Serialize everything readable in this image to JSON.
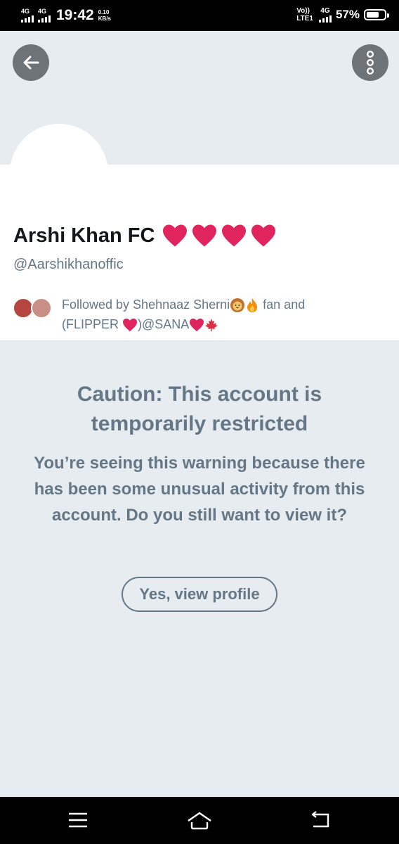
{
  "status_bar": {
    "network_1": "4G",
    "network_2": "4G",
    "time": "19:42",
    "speed_value": "0.10",
    "speed_unit": "KB/s",
    "volte_top": "Vo))",
    "volte_bottom": "LTE1",
    "data_type": "4G",
    "battery": "57%"
  },
  "profile": {
    "display_name": "Arshi Khan FC",
    "handle": "@Aarshikhanoffic",
    "followed_by_part1": "Followed by Shehnaaz Sherni",
    "followed_by_part2": " fan and",
    "followed_by_part3": "(FLIPPER ",
    "followed_by_part4": ")@SANA"
  },
  "warning": {
    "title": "Caution: This account is temporarily restricted",
    "body": "You’re seeing this warning because there has been some unusual activity from this account. Do you still want to view it?",
    "button_label": "Yes, view profile"
  },
  "colors": {
    "accent_text": "#657786",
    "heart_red": "#e0245e",
    "background": "#e6ecf0"
  },
  "icons": [
    "back-arrow-icon",
    "more-vertical-icon",
    "heart-icon",
    "lion-face-icon",
    "fire-icon",
    "maple-leaf-icon",
    "menu-icon",
    "home-icon",
    "back-nav-icon"
  ]
}
